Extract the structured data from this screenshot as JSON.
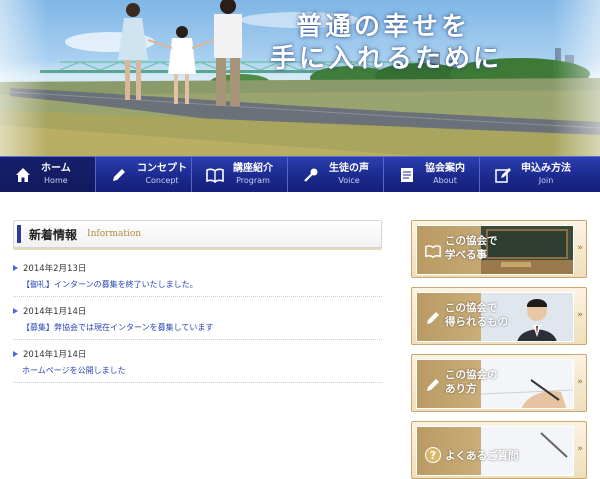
{
  "hero": {
    "slogan_line1": "普通の幸せを",
    "slogan_line2": "手に入れるために"
  },
  "nav": {
    "items": [
      {
        "jp": "ホーム",
        "en": "Home",
        "icon": "home-icon",
        "active": true
      },
      {
        "jp": "コンセプト",
        "en": "Concept",
        "icon": "pencil-icon"
      },
      {
        "jp": "講座紹介",
        "en": "Program",
        "icon": "book-icon"
      },
      {
        "jp": "生徒の声",
        "en": "Voice",
        "icon": "microphone-icon"
      },
      {
        "jp": "協会案内",
        "en": "About",
        "icon": "document-icon"
      },
      {
        "jp": "申込み方法",
        "en": "Join",
        "icon": "edit-icon"
      }
    ]
  },
  "info": {
    "title": "新着情報",
    "subtitle": "Information",
    "items": [
      {
        "date": "2014年2月13日",
        "text": "【御礼】インターンの募集を終了いたしました。"
      },
      {
        "date": "2014年1月14日",
        "text": "【募集】弊協会では現在インターンを募集しています"
      },
      {
        "date": "2014年1月14日",
        "text": "ホームページを公開しました"
      }
    ]
  },
  "banners": [
    {
      "line1": "この協会で",
      "line2": "学べる事",
      "icon": "book-icon"
    },
    {
      "line1": "この協会で",
      "line2": "得られるもの",
      "icon": "pencil-icon"
    },
    {
      "line1": "この協会の",
      "line2": "あり方",
      "icon": "pencil-icon"
    },
    {
      "line1": "よくあるご質問",
      "line2": "",
      "icon": "question-icon"
    }
  ],
  "colors": {
    "nav_blue": "#1c2a8e",
    "link_blue": "#2a45b8",
    "gold": "#c9a66a"
  }
}
